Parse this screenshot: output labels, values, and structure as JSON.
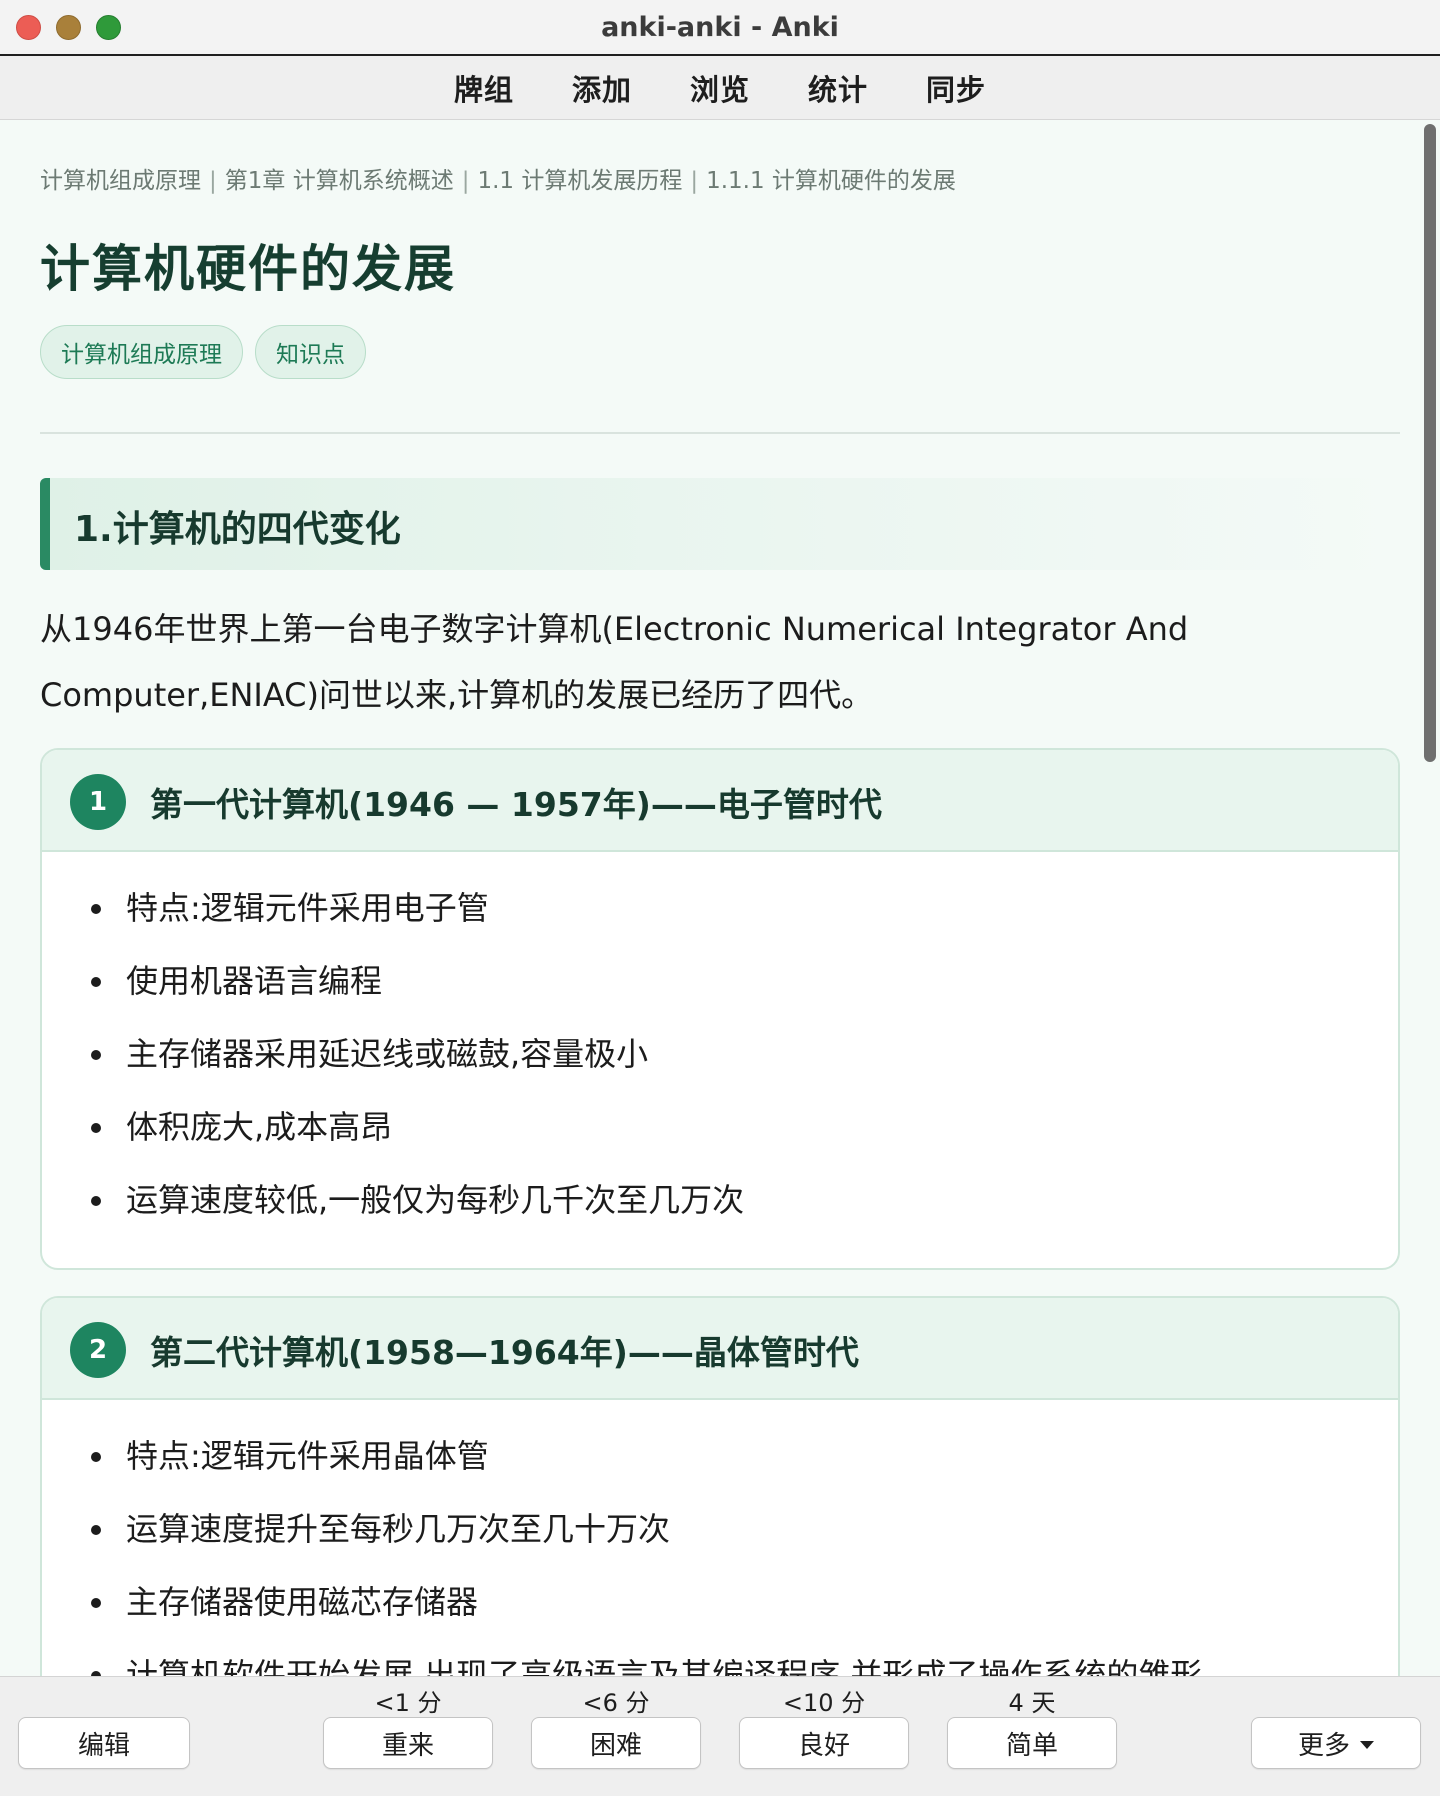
{
  "window": {
    "title": "anki-anki - Anki"
  },
  "topmenu": {
    "items": [
      "牌组",
      "添加",
      "浏览",
      "统计",
      "同步"
    ]
  },
  "card": {
    "breadcrumb": [
      "计算机组成原理",
      "第1章 计算机系统概述",
      "1.1 计算机发展历程",
      "1.1.1 计算机硬件的发展"
    ],
    "title": "计算机硬件的发展",
    "tags": [
      "计算机组成原理",
      "知识点"
    ],
    "section_heading": "1.计算机的四代变化",
    "intro": "从1946年世界上第一台电子数字计算机(Electronic Numerical Integrator And Computer,ENIAC)问世以来,计算机的发展已经历了四代。",
    "generations": [
      {
        "number": "1",
        "title": "第一代计算机(1946 — 1957年)——电子管时代",
        "points": [
          "特点:逻辑元件采用电子管",
          "使用机器语言编程",
          "主存储器采用延迟线或磁鼓,容量极小",
          "体积庞大,成本高昂",
          "运算速度较低,一般仅为每秒几千次至几万次"
        ]
      },
      {
        "number": "2",
        "title": "第二代计算机(1958—1964年)——晶体管时代",
        "points": [
          "特点:逻辑元件采用晶体管",
          "运算速度提升至每秒几万次至几十万次",
          "主存储器使用磁芯存储器",
          "计算机软件开始发展,出现了高级语言及其编译程序,并形成了操作系统的雏形"
        ]
      }
    ]
  },
  "bottombar": {
    "edit_label": "编辑",
    "answers": [
      {
        "time": "<1 分",
        "label": "重来"
      },
      {
        "time": "<6 分",
        "label": "困难"
      },
      {
        "time": "<10 分",
        "label": "良好"
      },
      {
        "time": "4 天",
        "label": "简单"
      }
    ],
    "more_label": "更多"
  }
}
